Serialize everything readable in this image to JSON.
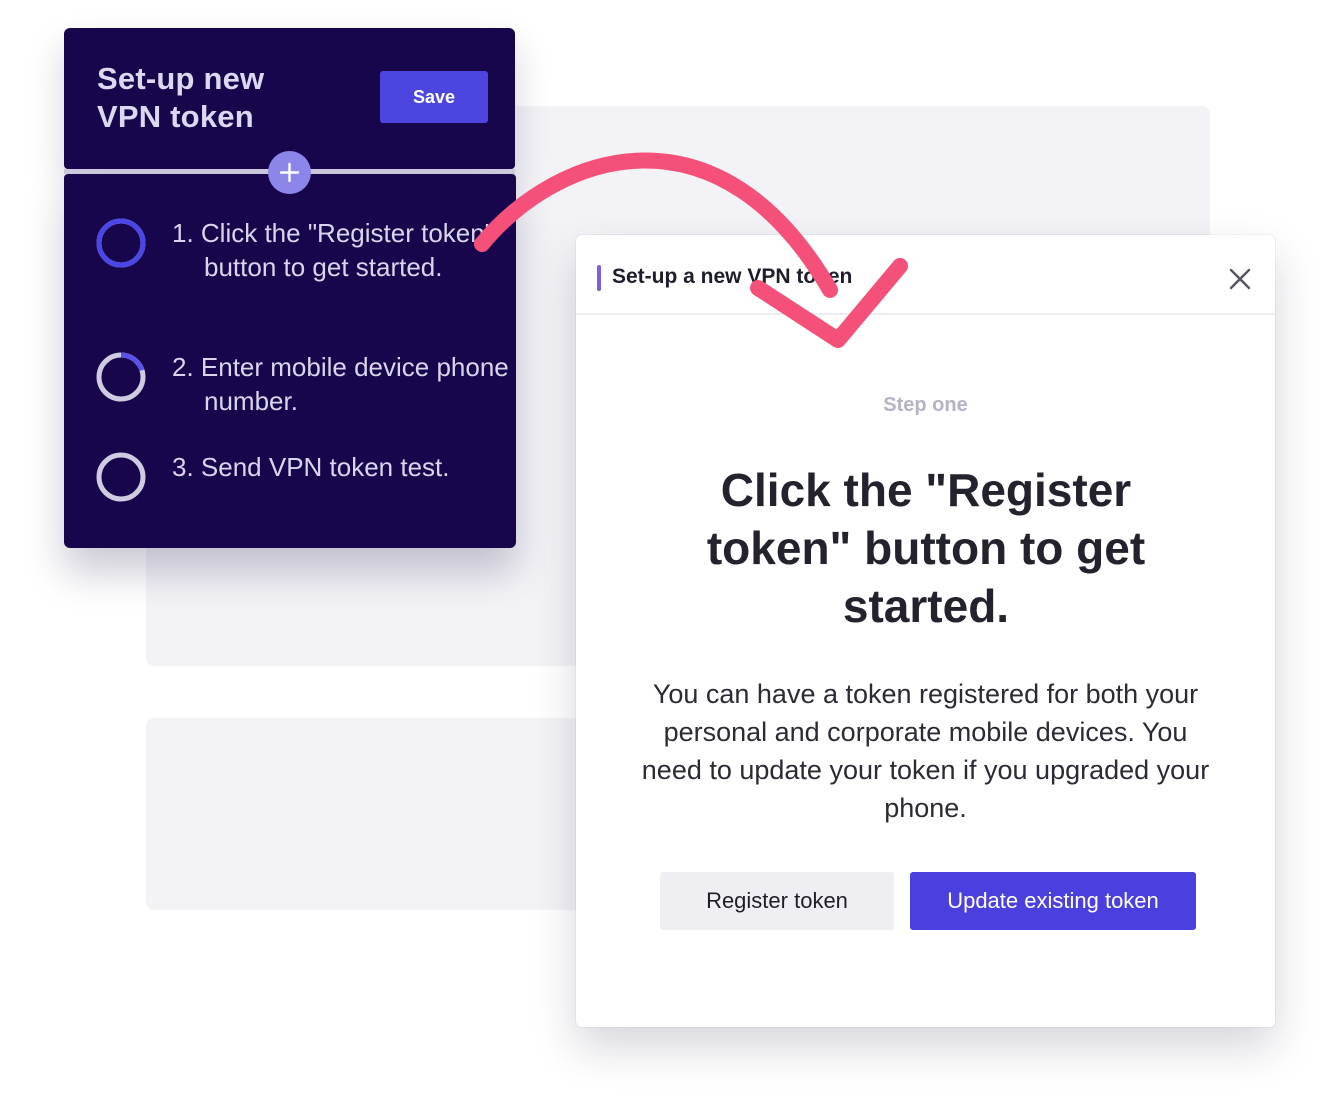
{
  "left_panel": {
    "title": "Set-up new VPN token",
    "save_label": "Save",
    "steps": [
      {
        "label": "1. Click the \"Register token\" button to get started.",
        "progress": 1.0
      },
      {
        "label": "2. Enter mobile device phone number.",
        "progress": 0.2
      },
      {
        "label": "3. Send VPN token test.",
        "progress": 0.0
      }
    ]
  },
  "modal": {
    "title": "Set-up a new VPN token",
    "step_label": "Step one",
    "headline": "Click the \"Register token\" button to get started.",
    "body": "You can have a token registered for both your personal and corporate mobile devices. You need to update your token if you upgraded your phone.",
    "register_label": "Register token",
    "update_label": "Update existing token"
  },
  "colors": {
    "panel_bg": "#17064b",
    "accent": "#4b3fe0",
    "arrow": "#f4507a",
    "ring_active": "#4b46e6",
    "ring_idle": "#cfcbe0"
  },
  "icons": {
    "add": "plus-icon",
    "close": "close-icon",
    "arrow": "curved-arrow-icon"
  }
}
